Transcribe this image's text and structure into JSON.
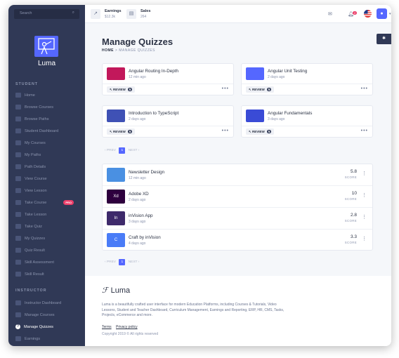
{
  "search": {
    "placeholder": "Search"
  },
  "brand": {
    "name": "Luma"
  },
  "sidebar": {
    "student_title": "STUDENT",
    "student_items": [
      "Home",
      "Browse Courses",
      "Browse Paths",
      "Student Dashboard",
      "My Courses",
      "My Paths",
      "Path Details",
      "View Course",
      "View Lesson",
      "Take Course",
      "Take Lesson",
      "Take Quiz",
      "My Quizzes",
      "Quiz Result",
      "Skill Assessment",
      "Skill Result"
    ],
    "pro_badge": "PRO",
    "instructor_title": "INSTRUCTOR",
    "instructor_items": [
      "Instructor Dashboard",
      "Manage Courses",
      "Manage Quizzes",
      "Earnings"
    ],
    "active_item": "Manage Quizzes"
  },
  "header": {
    "earnings_label": "Earnings",
    "earnings_value": "$12.3k",
    "sales_label": "Sales",
    "sales_value": "264",
    "notification_count": "2"
  },
  "page": {
    "title": "Manage Quizzes",
    "crumb_home": "HOME",
    "crumb_sep": ">",
    "crumb_current": "MANAGE QUIZZES"
  },
  "cards": [
    {
      "title": "Angular Routing In-Depth",
      "time": "12 min ago",
      "review": "REVIEW",
      "count": "5",
      "color": "#c2185b"
    },
    {
      "title": "Angular Unit Testing",
      "time": "2 days ago",
      "review": "REVIEW",
      "count": "5",
      "color": "#5567ff"
    },
    {
      "title": "Introduction to TypeScript",
      "time": "2 days ago",
      "review": "REVIEW",
      "count": "5",
      "color": "#3f51b5"
    },
    {
      "title": "Angular Fundamentals",
      "time": "3 days ago",
      "review": "REVIEW",
      "count": "5",
      "color": "#3a4bd6"
    }
  ],
  "pager": {
    "prev": "‹ PREV",
    "page": "1",
    "next": "NEXT ›"
  },
  "list": [
    {
      "title": "Newsletter Design",
      "time": "12 min ago",
      "score": "5.8",
      "score_label": "SCORE",
      "color": "#4a90e2"
    },
    {
      "title": "Adobe XD",
      "time": "2 days ago",
      "score": "10",
      "score_label": "SCORE",
      "color": "#2e003e"
    },
    {
      "title": "inVision App",
      "time": "3 days ago",
      "score": "2.8",
      "score_label": "SCORE",
      "color": "#3e2a6b"
    },
    {
      "title": "Craft by inVision",
      "time": "4 days ago",
      "score": "3.3",
      "score_label": "SCORE",
      "color": "#4a7cf7"
    }
  ],
  "footer": {
    "brand": "Luma",
    "description": "Luma is a beautifully crafted user interface for modern Education Platforms, including Courses & Tutorials, Video Lessons, Student and Teacher Dashboard, Curriculum Management, Earnings and Reporting, ERP, HR, CMS, Tasks, Projects, eCommerce and more.",
    "terms": "Terms",
    "privacy": "Privacy policy",
    "copyright": "Copyright 2019 © All rights reserved"
  }
}
